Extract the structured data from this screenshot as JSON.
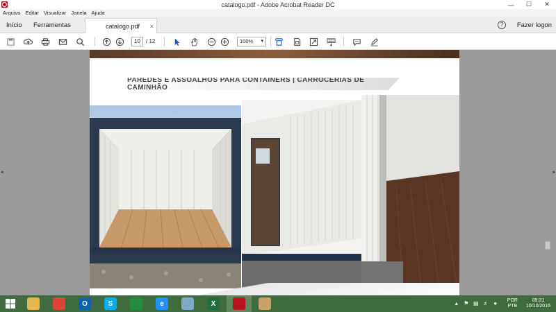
{
  "window": {
    "title": "catalogo.pdf - Adobe Acrobat Reader DC",
    "minimize": "—",
    "maximize": "☐",
    "close": "✕"
  },
  "menu": [
    "Arquivo",
    "Editar",
    "Visualizar",
    "Janela",
    "Ajuda"
  ],
  "tabs": {
    "home": "Início",
    "tools": "Ferramentas",
    "document": "catalogo.pdf",
    "close": "×",
    "help": "?",
    "login": "Fazer logon"
  },
  "toolbar": {
    "current_page": "10",
    "total_pages": "/ 12",
    "zoom": "100%",
    "zoom_caret": "▾",
    "icons": [
      "save-icon",
      "upload-icon",
      "print-icon",
      "mail-icon",
      "search-icon",
      "page-up-icon",
      "page-down-icon",
      "select-cursor-icon",
      "hand-icon",
      "zoom-out-icon",
      "zoom-in-icon",
      "fit-page-icon",
      "scroll-mode-icon",
      "fullscreen-icon",
      "keyboard-icon",
      "comment-icon",
      "sign-icon"
    ]
  },
  "document": {
    "heading": "PAREDES E ASSOALHOS PARA CONTAINERS | CARROCERIAS DE CAMINHÃO",
    "left_arrow": "◂",
    "right_arrow": "▸"
  },
  "taskbar": {
    "apps": [
      {
        "name": "file-explorer",
        "color": "#e8b64a",
        "glyph": ""
      },
      {
        "name": "chrome",
        "color": "#db4437",
        "glyph": ""
      },
      {
        "name": "outlook",
        "color": "#0a64ad",
        "glyph": "O"
      },
      {
        "name": "skype",
        "color": "#00aff0",
        "glyph": "S"
      },
      {
        "name": "sheets",
        "color": "#1e8e3e",
        "glyph": ""
      },
      {
        "name": "internet-explorer",
        "color": "#1e90ff",
        "glyph": "e"
      },
      {
        "name": "notes",
        "color": "#7fa9c9",
        "glyph": ""
      },
      {
        "name": "excel",
        "color": "#1d6f42",
        "glyph": "X"
      },
      {
        "name": "acrobat",
        "color": "#b8131c",
        "glyph": ""
      },
      {
        "name": "paint",
        "color": "#c9a26a",
        "glyph": ""
      }
    ],
    "lang_top": "POR",
    "lang_bottom": "PTB",
    "time": "09:31",
    "date": "10/10/2016",
    "tray_up": "▴"
  },
  "colors": {
    "titlebar": "#ffffff",
    "taskbar": "#3f6b3f",
    "docbg": "#9b9b9b",
    "accent": "#b8131c"
  }
}
